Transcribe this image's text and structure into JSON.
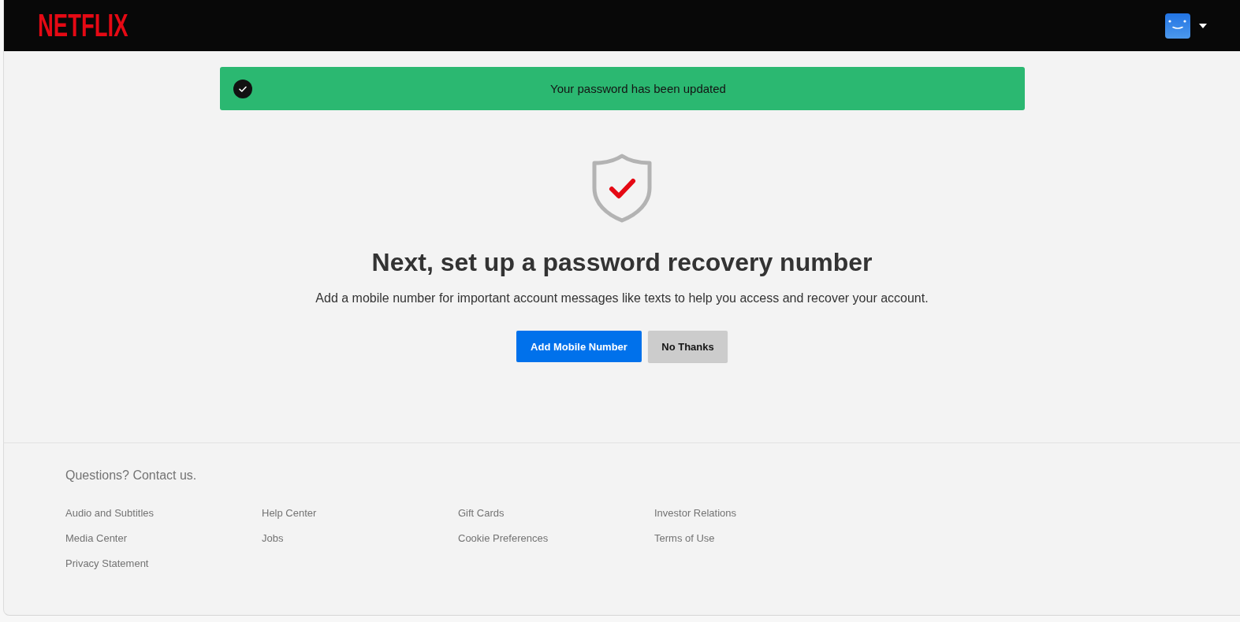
{
  "header": {
    "logo": "NETFLIX"
  },
  "banner": {
    "message": "Your password has been updated"
  },
  "main": {
    "heading": "Next, set up a password recovery number",
    "description": "Add a mobile number for important account messages like texts to help you access and recover your account.",
    "buttons": [
      {
        "label": "Add Mobile Number",
        "kind": "primary"
      },
      {
        "label": "No Thanks",
        "kind": "secondary"
      }
    ]
  },
  "footer": {
    "contact": "Questions? Contact us.",
    "links": [
      "Audio and Subtitles",
      "Help Center",
      "Gift Cards",
      "Investor Relations",
      "Media Center",
      "Jobs",
      "Cookie Preferences",
      "Terms of Use",
      "Privacy Statement"
    ]
  }
}
